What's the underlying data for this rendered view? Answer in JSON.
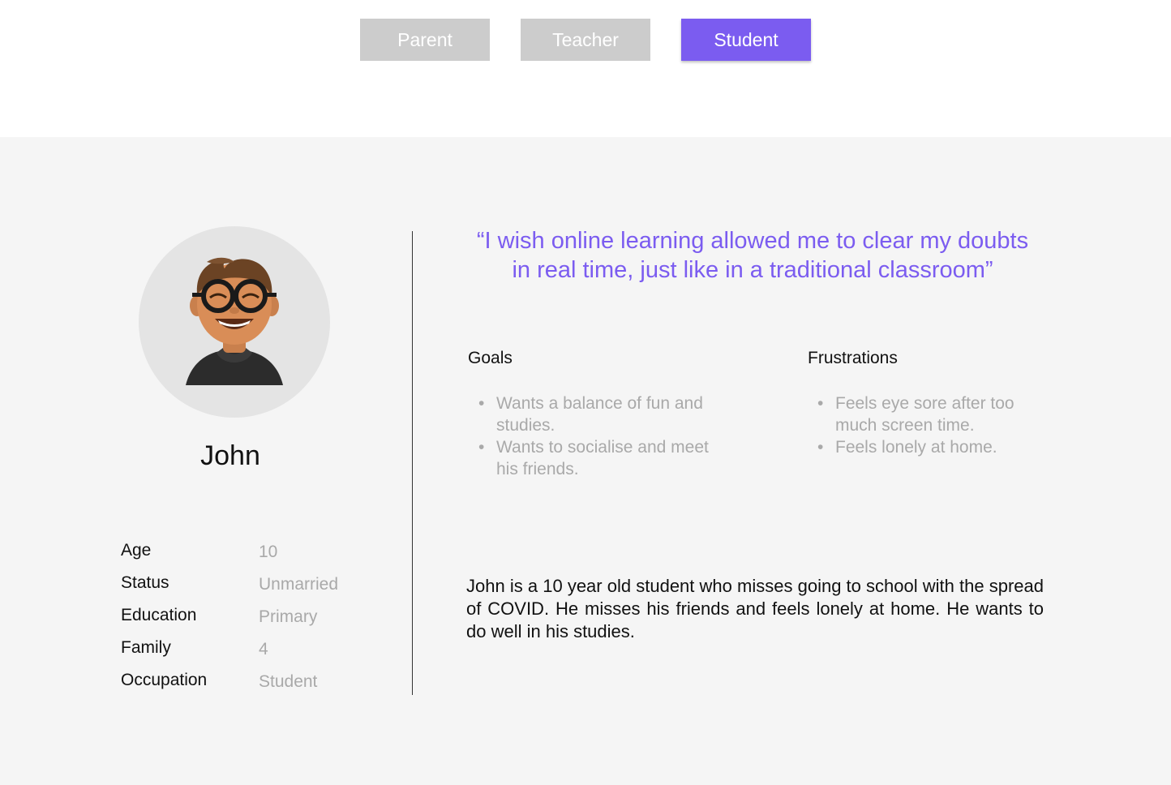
{
  "tabs": [
    {
      "label": "Parent",
      "active": false
    },
    {
      "label": "Teacher",
      "active": false
    },
    {
      "label": "Student",
      "active": true
    }
  ],
  "colors": {
    "accent": "#7b5cf0",
    "inactive_tab": "#cccccc",
    "panel_background": "#f5f5f5",
    "muted_text": "#a9a9a9"
  },
  "persona": {
    "name": "John",
    "avatar_icon": "student-avatar-illustration",
    "details": [
      {
        "label": "Age",
        "value": "10"
      },
      {
        "label": "Status",
        "value": "Unmarried"
      },
      {
        "label": "Education",
        "value": "Primary"
      },
      {
        "label": "Family",
        "value": "4"
      },
      {
        "label": "Occupation",
        "value": "Student"
      }
    ],
    "quote": "“I wish online learning allowed me to clear my doubts in real time, just like in a traditional classroom”",
    "goals": {
      "title": "Goals",
      "items": [
        "Wants a balance of fun and studies.",
        "Wants to socialise and meet his friends."
      ]
    },
    "frustrations": {
      "title": "Frustrations",
      "items": [
        "Feels eye sore after too much screen time.",
        "Feels lonely at home."
      ]
    },
    "bio": "John is a 10 year old student who misses going to school with the spread of COVID. He misses his friends and feels lonely at home. He wants to do well in his studies."
  }
}
